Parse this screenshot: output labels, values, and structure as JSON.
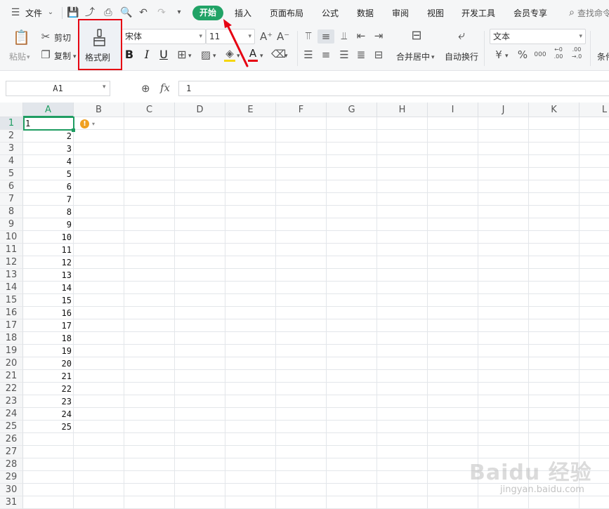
{
  "menubar": {
    "file_label": "文件",
    "tabs": [
      "开始",
      "插入",
      "页面布局",
      "公式",
      "数据",
      "审阅",
      "视图",
      "开发工具",
      "会员专享"
    ],
    "search_label": "查找命令"
  },
  "ribbon": {
    "paste_label": "粘贴",
    "cut_label": "剪切",
    "copy_label": "复制",
    "format_painter_label": "格式刷",
    "font_name": "宋体",
    "font_size": "11",
    "merge_label": "合并居中",
    "wrap_label": "自动换行",
    "number_format": "文本",
    "currency_symbol": "¥",
    "percent_symbol": "%",
    "thousands_symbol": "000",
    "inc_decimal": "←0 .00",
    "dec_decimal": ".00 →.0",
    "cond_label": "条件"
  },
  "formula_bar": {
    "name_box": "A1",
    "fx": "fx",
    "value": "1"
  },
  "sheet": {
    "columns": [
      "A",
      "B",
      "C",
      "D",
      "E",
      "F",
      "G",
      "H",
      "I",
      "J",
      "K",
      "L"
    ],
    "rows": [
      "1",
      "2",
      "3",
      "4",
      "5",
      "6",
      "7",
      "8",
      "9",
      "10",
      "11",
      "12",
      "13",
      "14",
      "15",
      "16",
      "17",
      "18",
      "19",
      "20",
      "21",
      "22",
      "23",
      "24",
      "25",
      "26",
      "27",
      "28",
      "29",
      "30",
      "31"
    ],
    "column_a_values": [
      "1",
      "2",
      "3",
      "4",
      "5",
      "6",
      "7",
      "8",
      "9",
      "10",
      "11",
      "12",
      "13",
      "14",
      "15",
      "16",
      "17",
      "18",
      "19",
      "20",
      "21",
      "22",
      "23",
      "24",
      "25"
    ]
  },
  "colors": {
    "accent_green": "#21a366",
    "highlight_red": "#e60012",
    "warning_orange": "#f0a020"
  },
  "watermark": {
    "brand": "Baidu 经验",
    "url": "jingyan.baidu.com"
  }
}
